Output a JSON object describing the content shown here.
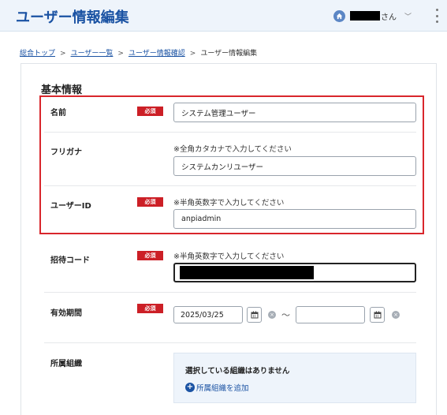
{
  "header": {
    "title": "ユーザー情報編集",
    "user_suffix": "さん",
    "chevron": "﹀"
  },
  "breadcrumb": {
    "items": [
      "総合トップ",
      "ユーザー一覧",
      "ユーザー情報確認"
    ],
    "current": "ユーザー情報編集",
    "separator": ">"
  },
  "form": {
    "section_title": "基本情報",
    "required_label": "必須",
    "name": {
      "label": "名前",
      "value": "システム管理ユーザー"
    },
    "furigana": {
      "label": "フリガナ",
      "hint": "※全角カタカナで入力してください",
      "value": "システムカンリユーザー"
    },
    "user_id": {
      "label": "ユーザーID",
      "hint": "※半角英数字で入力してください",
      "value": "anpiadmin"
    },
    "invite_code": {
      "label": "招待コード",
      "hint": "※半角英数字で入力してください"
    },
    "validity": {
      "label": "有効期間",
      "start": "2025/03/25",
      "end": "",
      "tilde": "～"
    },
    "organization": {
      "label": "所属組織",
      "none_text": "選択している組織はありません",
      "add_label": "所属組織を追加"
    }
  },
  "colors": {
    "brand": "#1a52a3",
    "required": "#cc1f26",
    "highlight": "#d9262c",
    "header_bg": "#eef4fb"
  },
  "icons": [
    "home-user-icon",
    "chevron-down-icon",
    "kebab-menu-icon",
    "calendar-icon",
    "clear-icon",
    "plus-circle-icon"
  ]
}
